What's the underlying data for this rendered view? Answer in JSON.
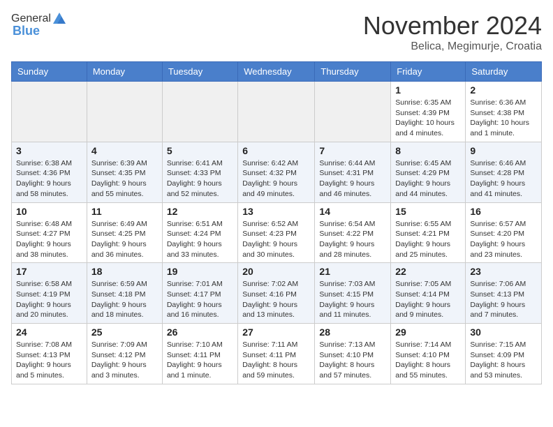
{
  "logo": {
    "general": "General",
    "blue": "Blue"
  },
  "header": {
    "month": "November 2024",
    "location": "Belica, Megimurje, Croatia"
  },
  "days_of_week": [
    "Sunday",
    "Monday",
    "Tuesday",
    "Wednesday",
    "Thursday",
    "Friday",
    "Saturday"
  ],
  "weeks": [
    [
      {
        "day": "",
        "empty": true
      },
      {
        "day": "",
        "empty": true
      },
      {
        "day": "",
        "empty": true
      },
      {
        "day": "",
        "empty": true
      },
      {
        "day": "",
        "empty": true
      },
      {
        "day": "1",
        "sunrise": "Sunrise: 6:35 AM",
        "sunset": "Sunset: 4:39 PM",
        "daylight": "Daylight: 10 hours and 4 minutes."
      },
      {
        "day": "2",
        "sunrise": "Sunrise: 6:36 AM",
        "sunset": "Sunset: 4:38 PM",
        "daylight": "Daylight: 10 hours and 1 minute."
      }
    ],
    [
      {
        "day": "3",
        "sunrise": "Sunrise: 6:38 AM",
        "sunset": "Sunset: 4:36 PM",
        "daylight": "Daylight: 9 hours and 58 minutes."
      },
      {
        "day": "4",
        "sunrise": "Sunrise: 6:39 AM",
        "sunset": "Sunset: 4:35 PM",
        "daylight": "Daylight: 9 hours and 55 minutes."
      },
      {
        "day": "5",
        "sunrise": "Sunrise: 6:41 AM",
        "sunset": "Sunset: 4:33 PM",
        "daylight": "Daylight: 9 hours and 52 minutes."
      },
      {
        "day": "6",
        "sunrise": "Sunrise: 6:42 AM",
        "sunset": "Sunset: 4:32 PM",
        "daylight": "Daylight: 9 hours and 49 minutes."
      },
      {
        "day": "7",
        "sunrise": "Sunrise: 6:44 AM",
        "sunset": "Sunset: 4:31 PM",
        "daylight": "Daylight: 9 hours and 46 minutes."
      },
      {
        "day": "8",
        "sunrise": "Sunrise: 6:45 AM",
        "sunset": "Sunset: 4:29 PM",
        "daylight": "Daylight: 9 hours and 44 minutes."
      },
      {
        "day": "9",
        "sunrise": "Sunrise: 6:46 AM",
        "sunset": "Sunset: 4:28 PM",
        "daylight": "Daylight: 9 hours and 41 minutes."
      }
    ],
    [
      {
        "day": "10",
        "sunrise": "Sunrise: 6:48 AM",
        "sunset": "Sunset: 4:27 PM",
        "daylight": "Daylight: 9 hours and 38 minutes."
      },
      {
        "day": "11",
        "sunrise": "Sunrise: 6:49 AM",
        "sunset": "Sunset: 4:25 PM",
        "daylight": "Daylight: 9 hours and 36 minutes."
      },
      {
        "day": "12",
        "sunrise": "Sunrise: 6:51 AM",
        "sunset": "Sunset: 4:24 PM",
        "daylight": "Daylight: 9 hours and 33 minutes."
      },
      {
        "day": "13",
        "sunrise": "Sunrise: 6:52 AM",
        "sunset": "Sunset: 4:23 PM",
        "daylight": "Daylight: 9 hours and 30 minutes."
      },
      {
        "day": "14",
        "sunrise": "Sunrise: 6:54 AM",
        "sunset": "Sunset: 4:22 PM",
        "daylight": "Daylight: 9 hours and 28 minutes."
      },
      {
        "day": "15",
        "sunrise": "Sunrise: 6:55 AM",
        "sunset": "Sunset: 4:21 PM",
        "daylight": "Daylight: 9 hours and 25 minutes."
      },
      {
        "day": "16",
        "sunrise": "Sunrise: 6:57 AM",
        "sunset": "Sunset: 4:20 PM",
        "daylight": "Daylight: 9 hours and 23 minutes."
      }
    ],
    [
      {
        "day": "17",
        "sunrise": "Sunrise: 6:58 AM",
        "sunset": "Sunset: 4:19 PM",
        "daylight": "Daylight: 9 hours and 20 minutes."
      },
      {
        "day": "18",
        "sunrise": "Sunrise: 6:59 AM",
        "sunset": "Sunset: 4:18 PM",
        "daylight": "Daylight: 9 hours and 18 minutes."
      },
      {
        "day": "19",
        "sunrise": "Sunrise: 7:01 AM",
        "sunset": "Sunset: 4:17 PM",
        "daylight": "Daylight: 9 hours and 16 minutes."
      },
      {
        "day": "20",
        "sunrise": "Sunrise: 7:02 AM",
        "sunset": "Sunset: 4:16 PM",
        "daylight": "Daylight: 9 hours and 13 minutes."
      },
      {
        "day": "21",
        "sunrise": "Sunrise: 7:03 AM",
        "sunset": "Sunset: 4:15 PM",
        "daylight": "Daylight: 9 hours and 11 minutes."
      },
      {
        "day": "22",
        "sunrise": "Sunrise: 7:05 AM",
        "sunset": "Sunset: 4:14 PM",
        "daylight": "Daylight: 9 hours and 9 minutes."
      },
      {
        "day": "23",
        "sunrise": "Sunrise: 7:06 AM",
        "sunset": "Sunset: 4:13 PM",
        "daylight": "Daylight: 9 hours and 7 minutes."
      }
    ],
    [
      {
        "day": "24",
        "sunrise": "Sunrise: 7:08 AM",
        "sunset": "Sunset: 4:13 PM",
        "daylight": "Daylight: 9 hours and 5 minutes."
      },
      {
        "day": "25",
        "sunrise": "Sunrise: 7:09 AM",
        "sunset": "Sunset: 4:12 PM",
        "daylight": "Daylight: 9 hours and 3 minutes."
      },
      {
        "day": "26",
        "sunrise": "Sunrise: 7:10 AM",
        "sunset": "Sunset: 4:11 PM",
        "daylight": "Daylight: 9 hours and 1 minute."
      },
      {
        "day": "27",
        "sunrise": "Sunrise: 7:11 AM",
        "sunset": "Sunset: 4:11 PM",
        "daylight": "Daylight: 8 hours and 59 minutes."
      },
      {
        "day": "28",
        "sunrise": "Sunrise: 7:13 AM",
        "sunset": "Sunset: 4:10 PM",
        "daylight": "Daylight: 8 hours and 57 minutes."
      },
      {
        "day": "29",
        "sunrise": "Sunrise: 7:14 AM",
        "sunset": "Sunset: 4:10 PM",
        "daylight": "Daylight: 8 hours and 55 minutes."
      },
      {
        "day": "30",
        "sunrise": "Sunrise: 7:15 AM",
        "sunset": "Sunset: 4:09 PM",
        "daylight": "Daylight: 8 hours and 53 minutes."
      }
    ]
  ]
}
